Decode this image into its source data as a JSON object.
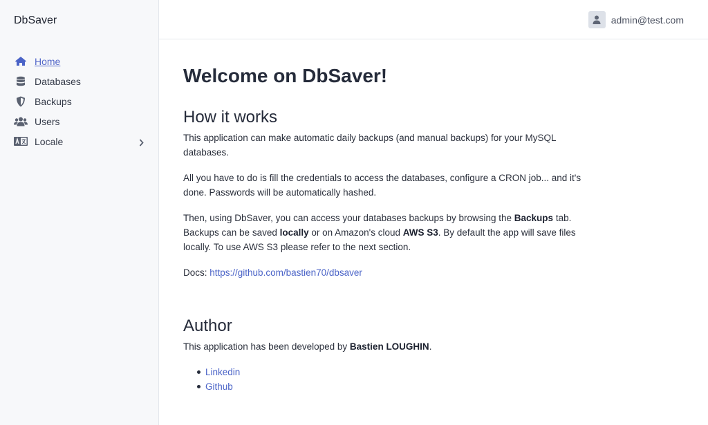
{
  "sidebar": {
    "brand": "DbSaver",
    "items": [
      {
        "label": "Home",
        "icon": "home-icon"
      },
      {
        "label": "Databases",
        "icon": "database-icon"
      },
      {
        "label": "Backups",
        "icon": "shield-icon"
      },
      {
        "label": "Users",
        "icon": "users-icon"
      },
      {
        "label": "Locale",
        "icon": "language-icon"
      }
    ]
  },
  "header": {
    "user_email": "admin@test.com"
  },
  "main": {
    "title": "Welcome on DbSaver!",
    "how_it_works": {
      "heading": "How it works",
      "p1": "This application can make automatic daily backups (and manual backups) for your MySQL databases.",
      "p2": "All you have to do is fill the credentials to access the databases, configure a CRON job... and it's done. Passwords will be automatically hashed.",
      "p3_a": "Then, using DbSaver, you can access your databases backups by browsing the ",
      "p3_b": "Backups",
      "p3_c": " tab. Backups can be saved ",
      "p3_d": "locally",
      "p3_e": " or on Amazon's cloud ",
      "p3_f": "AWS S3",
      "p3_g": ". By default the app will save files locally. To use AWS S3 please refer to the next section.",
      "docs_label": "Docs: ",
      "docs_link": "https://github.com/bastien70/dbsaver"
    },
    "author": {
      "heading": "Author",
      "text_a": "This application has been developed by ",
      "name": "Bastien LOUGHIN",
      "text_b": ".",
      "links": [
        "Linkedin",
        "Github"
      ]
    }
  },
  "colors": {
    "accent": "#4a63c7",
    "sidebar_bg": "#f7f8fa",
    "icon": "#5a6170"
  }
}
